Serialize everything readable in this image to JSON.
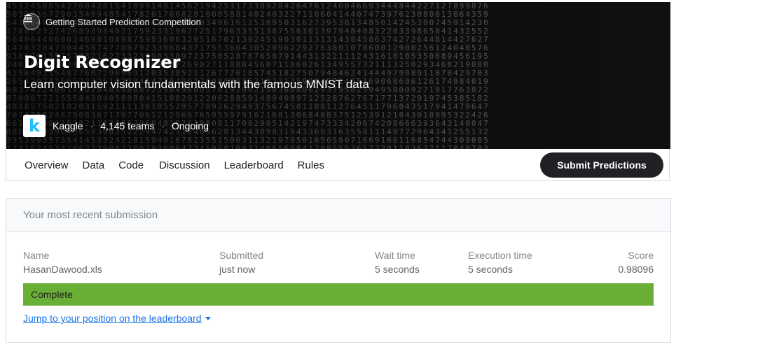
{
  "competition": {
    "badge": "Getting Started Prediction Competition",
    "title": "Digit Recognizer",
    "subtitle": "Learn computer vision fundamentals with the famous MNIST data",
    "host": "Kaggle",
    "teams": "4,145 teams",
    "status": "Ongoing"
  },
  "tabs": [
    "Overview",
    "Data",
    "Code",
    "Discussion",
    "Leaderboard",
    "Rules"
  ],
  "submit_label": "Submit Predictions",
  "submission": {
    "header": "Your most recent submission",
    "columns": {
      "name": "Name",
      "submitted": "Submitted",
      "wait_time": "Wait time",
      "execution_time": "Execution time",
      "score": "Score"
    },
    "values": {
      "name": "HasanDawood.xls",
      "submitted": "just now",
      "wait_time": "5 seconds",
      "execution_time": "5 seconds",
      "score": "0.98096"
    },
    "status": "Complete",
    "jump_link": "Jump to your position on the leaderboard"
  },
  "colors": {
    "complete_green": "#6aaf35",
    "button_dark": "#202124",
    "link_blue": "#1a73e8"
  }
}
